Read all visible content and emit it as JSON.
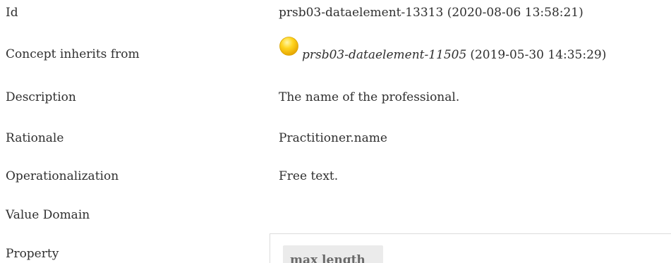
{
  "rows": {
    "id": {
      "label": "Id",
      "value": "prsb03-dataelement-13313 (2020-08-06 13:58:21)"
    },
    "inherits": {
      "label": "Concept inherits from",
      "ref_id": "prsb03-dataelement-11505",
      "ref_timestamp": "(2019-05-30 14:35:29)",
      "status_icon": "status-circle-icon",
      "status_color": "#f5c518"
    },
    "description": {
      "label": "Description",
      "value": "The name of the professional."
    },
    "rationale": {
      "label": "Rationale",
      "value": "Practitioner.name"
    },
    "operationalization": {
      "label": "Operationalization",
      "value": "Free text."
    },
    "value_domain": {
      "label": "Value Domain"
    },
    "property": {
      "label": "Property",
      "chip_label": "max length"
    }
  }
}
